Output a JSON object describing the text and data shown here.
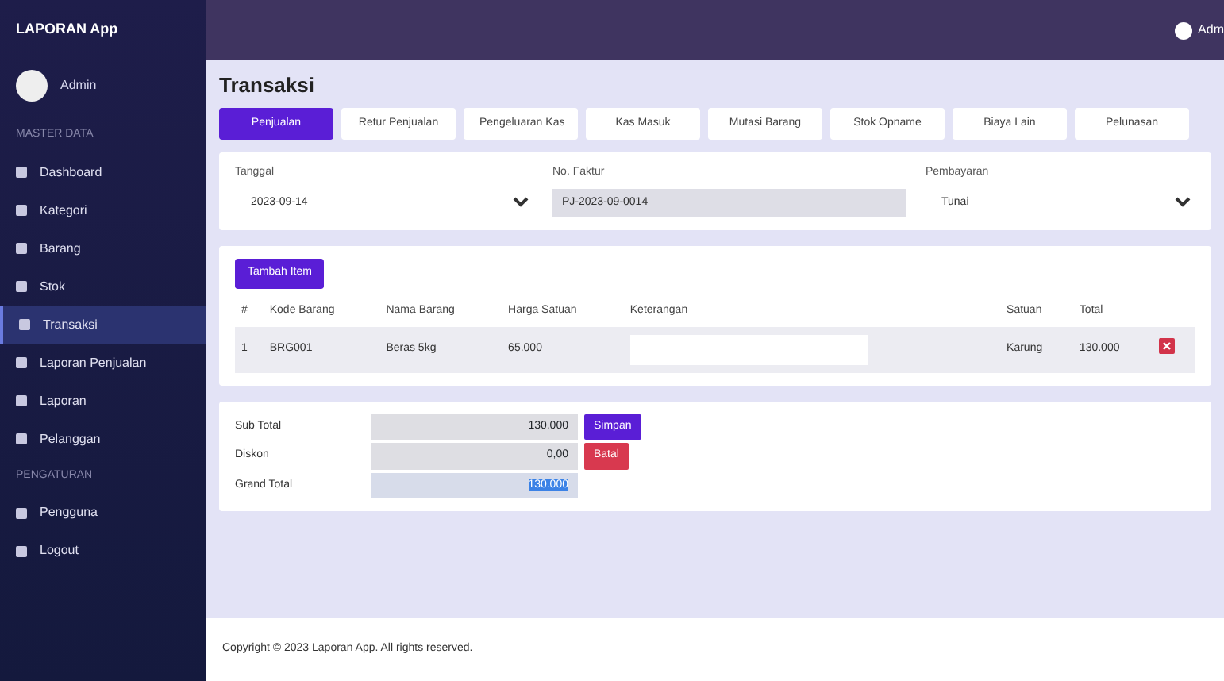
{
  "sidebar": {
    "brand": "LAPORAN App",
    "user": "Admin",
    "items": [
      {
        "kind": "header",
        "label": "MASTER DATA"
      },
      {
        "kind": "link",
        "label": "Dashboard",
        "selected": false
      },
      {
        "kind": "link",
        "label": "Kategori",
        "selected": false
      },
      {
        "kind": "link",
        "label": "Barang",
        "selected": false
      },
      {
        "kind": "link",
        "label": "Stok",
        "selected": false
      },
      {
        "kind": "link",
        "label": "Transaksi",
        "selected": true
      },
      {
        "kind": "link",
        "label": "Laporan Penjualan",
        "selected": false
      },
      {
        "kind": "link",
        "label": "Laporan",
        "selected": false
      },
      {
        "kind": "link",
        "label": "Pelanggan",
        "selected": false
      },
      {
        "kind": "header",
        "label": "PENGATURAN"
      },
      {
        "kind": "link",
        "label": "Pengguna",
        "selected": false
      },
      {
        "kind": "link",
        "label": "Logout",
        "selected": false
      }
    ]
  },
  "topbar": {
    "user": "Adm"
  },
  "page": {
    "title": "Transaksi"
  },
  "tabs": [
    {
      "label": "Penjualan",
      "selected": true
    },
    {
      "label": "Retur Penjualan",
      "selected": false
    },
    {
      "label": "Pengeluaran Kas",
      "selected": false
    },
    {
      "label": "Kas Masuk",
      "selected": false
    },
    {
      "label": "Mutasi Barang",
      "selected": false
    },
    {
      "label": "Stok Opname",
      "selected": false
    },
    {
      "label": "Biaya Lain",
      "selected": false
    },
    {
      "label": "Pelunasan",
      "selected": false
    }
  ],
  "header_fields": [
    {
      "label": "Tanggal",
      "value": "2023-09-14",
      "kind": "select"
    },
    {
      "label": "No. Faktur",
      "value": "PJ-2023-09-0014",
      "kind": "readonly"
    },
    {
      "label": "Pembayaran",
      "value": "Tunai",
      "kind": "select"
    }
  ],
  "items_table": {
    "add_button": "Tambah Item",
    "columns": [
      "#",
      "Kode Barang",
      "Nama Barang",
      "Harga Satuan",
      "Keterangan",
      "Satuan",
      "Total"
    ],
    "rows": [
      {
        "cells": [
          "1",
          "BRG001",
          "Beras 5kg",
          "65.000",
          "",
          "Karung",
          "130.000"
        ]
      }
    ]
  },
  "totals": [
    {
      "label": "Sub Total",
      "value": "130.000",
      "button": "Simpan",
      "color": "#5a1ed6",
      "highlight": false
    },
    {
      "label": "Diskon",
      "value": "0,00",
      "button": "Batal",
      "color": "#d8394f",
      "highlight": false
    },
    {
      "label": "Grand Total",
      "value": "130.000",
      "highlight": true
    }
  ],
  "footer": "Copyright © 2023 Laporan App. All rights reserved."
}
